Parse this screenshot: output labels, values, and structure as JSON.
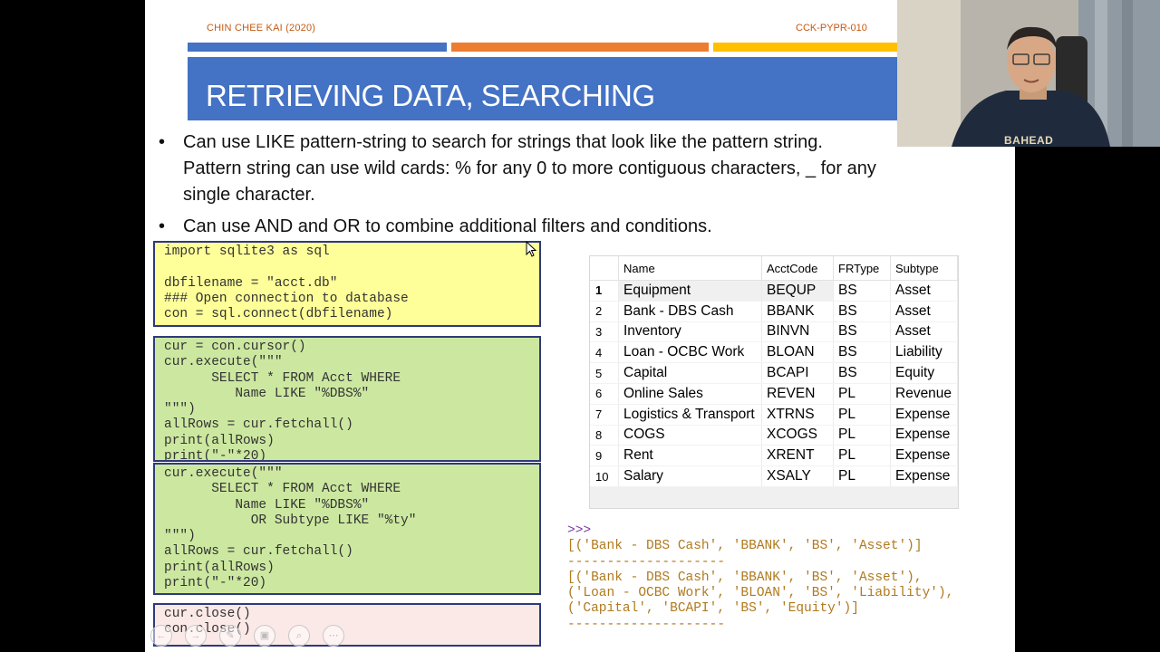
{
  "header": {
    "author": "CHIN CHEE KAI (2020)",
    "code": "CCK-PYPR-010"
  },
  "colors": {
    "bar_blue": "#4472c4",
    "bar_orange": "#ed7d31",
    "bar_yellow": "#ffc000",
    "code_yellow": "#ffff99",
    "code_green": "#cce8a0",
    "code_pink": "#fbe9e7",
    "code_border": "#2e3a7a"
  },
  "title": "RETRIEVING DATA, SEARCHING",
  "bullets": [
    {
      "line1": "Can use LIKE pattern-string to search for strings that look like the pattern string.",
      "line2": "Pattern string can use wild cards:  % for any 0 to more contiguous characters,  _ for any",
      "line3": "single character."
    },
    {
      "line1": "Can use AND and OR to combine additional filters and conditions."
    }
  ],
  "code_blocks": [
    "import sqlite3 as sql\n\ndbfilename = \"acct.db\"\n### Open connection to database\ncon = sql.connect(dbfilename)",
    "cur = con.cursor()\ncur.execute(\"\"\"\n      SELECT * FROM Acct WHERE\n         Name LIKE \"%DBS%\"\n\"\"\")\nallRows = cur.fetchall()\nprint(allRows)\nprint(\"-\"*20)",
    "cur.execute(\"\"\"\n      SELECT * FROM Acct WHERE\n         Name LIKE \"%DBS%\"\n           OR Subtype LIKE \"%ty\"\n\"\"\")\nallRows = cur.fetchall()\nprint(allRows)\nprint(\"-\"*20)",
    "cur.close()\ncon.close()"
  ],
  "table": {
    "columns": [
      "Name",
      "AcctCode",
      "FRType",
      "Subtype"
    ],
    "rows": [
      [
        "1",
        "Equipment",
        "BEQUP",
        "BS",
        "Asset"
      ],
      [
        "2",
        "Bank - DBS Cash",
        "BBANK",
        "BS",
        "Asset"
      ],
      [
        "3",
        "Inventory",
        "BINVN",
        "BS",
        "Asset"
      ],
      [
        "4",
        "Loan - OCBC Work",
        "BLOAN",
        "BS",
        "Liability"
      ],
      [
        "5",
        "Capital",
        "BCAPI",
        "BS",
        "Equity"
      ],
      [
        "6",
        "Online Sales",
        "REVEN",
        "PL",
        "Revenue"
      ],
      [
        "7",
        "Logistics & Transport",
        "XTRNS",
        "PL",
        "Expense"
      ],
      [
        "8",
        "COGS",
        "XCOGS",
        "PL",
        "Expense"
      ],
      [
        "9",
        "Rent",
        "XRENT",
        "PL",
        "Expense"
      ],
      [
        "10",
        "Salary",
        "XSALY",
        "PL",
        "Expense"
      ]
    ]
  },
  "output": {
    "prompt": ">>>",
    "lines": [
      "[('Bank - DBS Cash', 'BBANK', 'BS', 'Asset')]",
      "--------------------",
      "[('Bank - DBS Cash', 'BBANK', 'BS', 'Asset'),",
      "('Loan - OCBC Work', 'BLOAN', 'BS', 'Liability'),",
      "('Capital', 'BCAPI', 'BS', 'Equity')]",
      "--------------------"
    ]
  },
  "webcam": {
    "shirt_text": "BAHEAD"
  },
  "controls": [
    "prev-icon",
    "next-icon",
    "pen-icon",
    "slides-icon",
    "zoom-icon",
    "more-icon"
  ]
}
